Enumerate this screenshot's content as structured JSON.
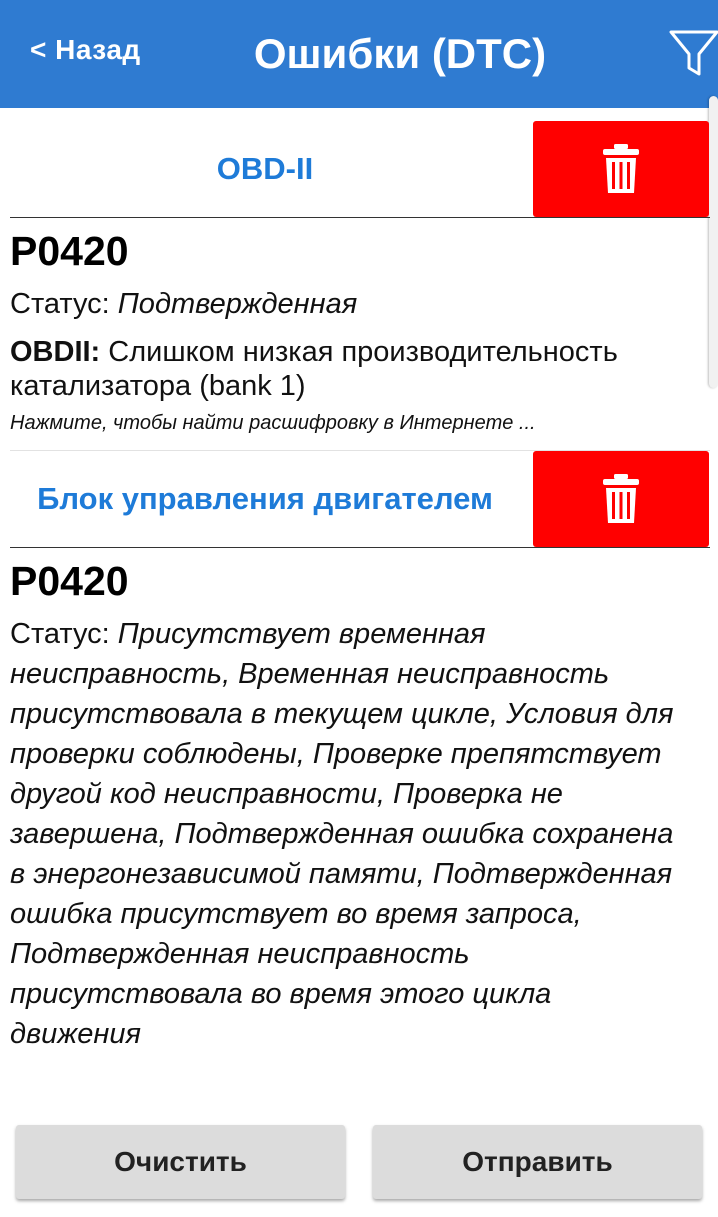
{
  "header": {
    "back_label": "< Назад",
    "title": "Ошибки (DTC)",
    "filter_icon": "filter-funnel-icon",
    "background_color": "#2f7bd1"
  },
  "sections": [
    {
      "title": "OBD-II",
      "delete_icon": "trash-icon",
      "code": "P0420",
      "status_label": "Статус: ",
      "status_value": "Подтвержденная",
      "desc_prefix": "OBDII: ",
      "desc_text": "Слишком низкая производительность катализатора (bank 1)",
      "hint": "Нажмите, чтобы найти расшифровку в Интернете ..."
    },
    {
      "title": "Блок управления двигателем",
      "delete_icon": "trash-icon",
      "code": "P0420",
      "status_label": "Статус: ",
      "status_value": "Присутствует временная неисправность, Временная неисправность присутствовала в текущем цикле, Условия для проверки соблюдены, Проверке препятствует другой код неисправности, Проверка не завершена, Подтвержденная ошибка сохранена в энергонезависимой памяти, Подтвержденная ошибка присутствует во время запроса, Подтвержденная неисправность присутствовала во время этого цикла движения"
    }
  ],
  "footer": {
    "clear_label": "Очистить",
    "send_label": "Отправить"
  },
  "colors": {
    "accent": "#1e7bd8",
    "delete": "#ff0000",
    "button": "#dcdcdc"
  }
}
